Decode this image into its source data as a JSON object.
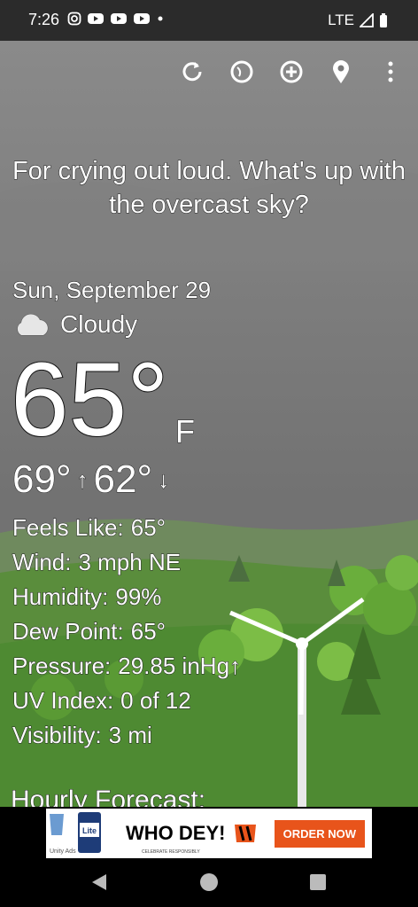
{
  "status": {
    "time": "7:26",
    "network": "LTE"
  },
  "toolbar": {
    "refresh": "refresh-icon",
    "themes": "theme-icon",
    "add": "add-location-icon",
    "location": "location-pin-icon",
    "menu": "more-vert-icon"
  },
  "weather": {
    "message": "For crying out loud. What's up with the overcast sky?",
    "date": "Sun, September 29",
    "condition": "Cloudy",
    "temperature": "65°",
    "unit": "F",
    "high": "69°",
    "low": "62°",
    "details": [
      {
        "label": "Feels Like:",
        "value": "65°"
      },
      {
        "label": "Wind:",
        "value": "3 mph NE"
      },
      {
        "label": "Humidity:",
        "value": "99%"
      },
      {
        "label": "Dew Point:",
        "value": "65°"
      },
      {
        "label": "Pressure:",
        "value": "29.85 inHg↑"
      },
      {
        "label": "UV Index:",
        "value": "0 of 12"
      },
      {
        "label": "Visibility:",
        "value": "3 mi"
      }
    ],
    "hourly_title": "Hourly Forecast:"
  },
  "ad": {
    "brand": "Lite",
    "headline": "WHO DEY!",
    "cta": "ORDER NOW",
    "network": "Unity Ads",
    "fineprint": "CELEBRATE RESPONSIBLY"
  },
  "colors": {
    "sky": "#7a7a7a",
    "grass": "#4e8a32",
    "tree": "#6aae3c",
    "ad_button": "#e8541b"
  }
}
